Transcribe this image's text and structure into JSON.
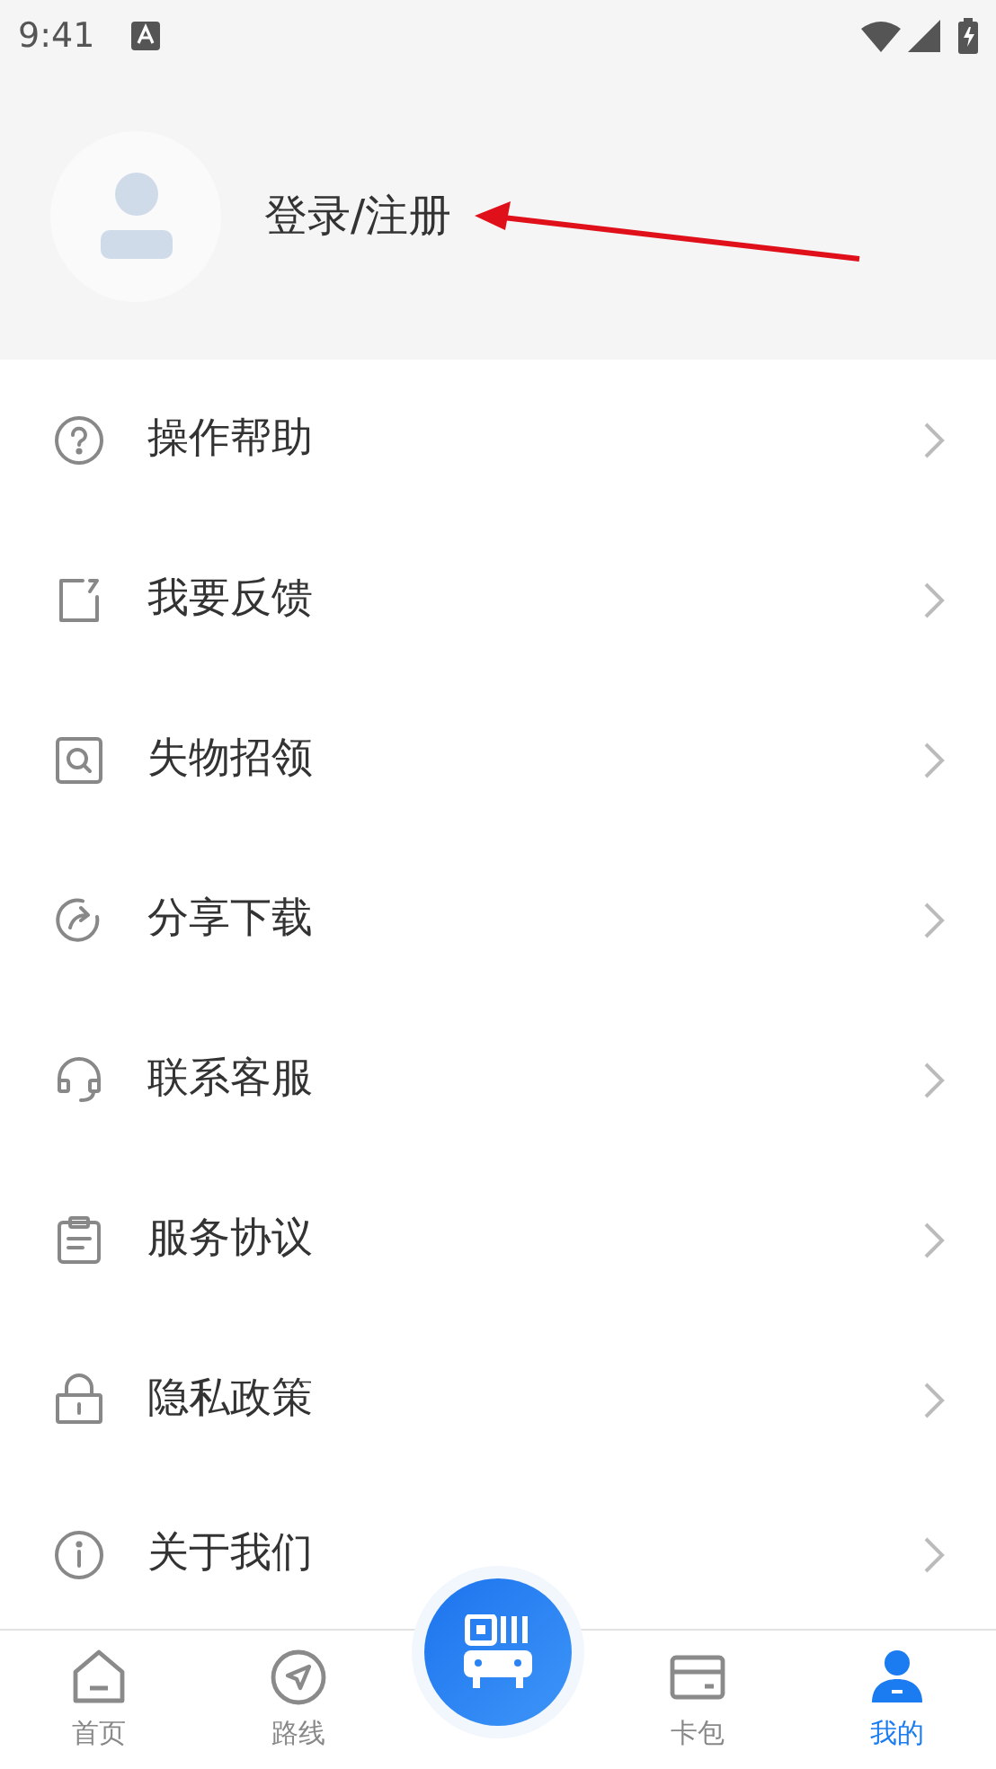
{
  "status_bar": {
    "time": "9:41"
  },
  "profile": {
    "login_label": "登录/注册"
  },
  "menu": [
    {
      "label": "操作帮助"
    },
    {
      "label": "我要反馈"
    },
    {
      "label": "失物招领"
    },
    {
      "label": "分享下载"
    },
    {
      "label": "联系客服"
    },
    {
      "label": "服务协议"
    },
    {
      "label": "隐私政策"
    },
    {
      "label": "关于我们"
    }
  ],
  "tab_bar": [
    {
      "label": "首页",
      "selected": false
    },
    {
      "label": "路线",
      "selected": false
    },
    {
      "kind": "center"
    },
    {
      "label": "卡包",
      "selected": false
    },
    {
      "label": "我的",
      "selected": true
    }
  ]
}
